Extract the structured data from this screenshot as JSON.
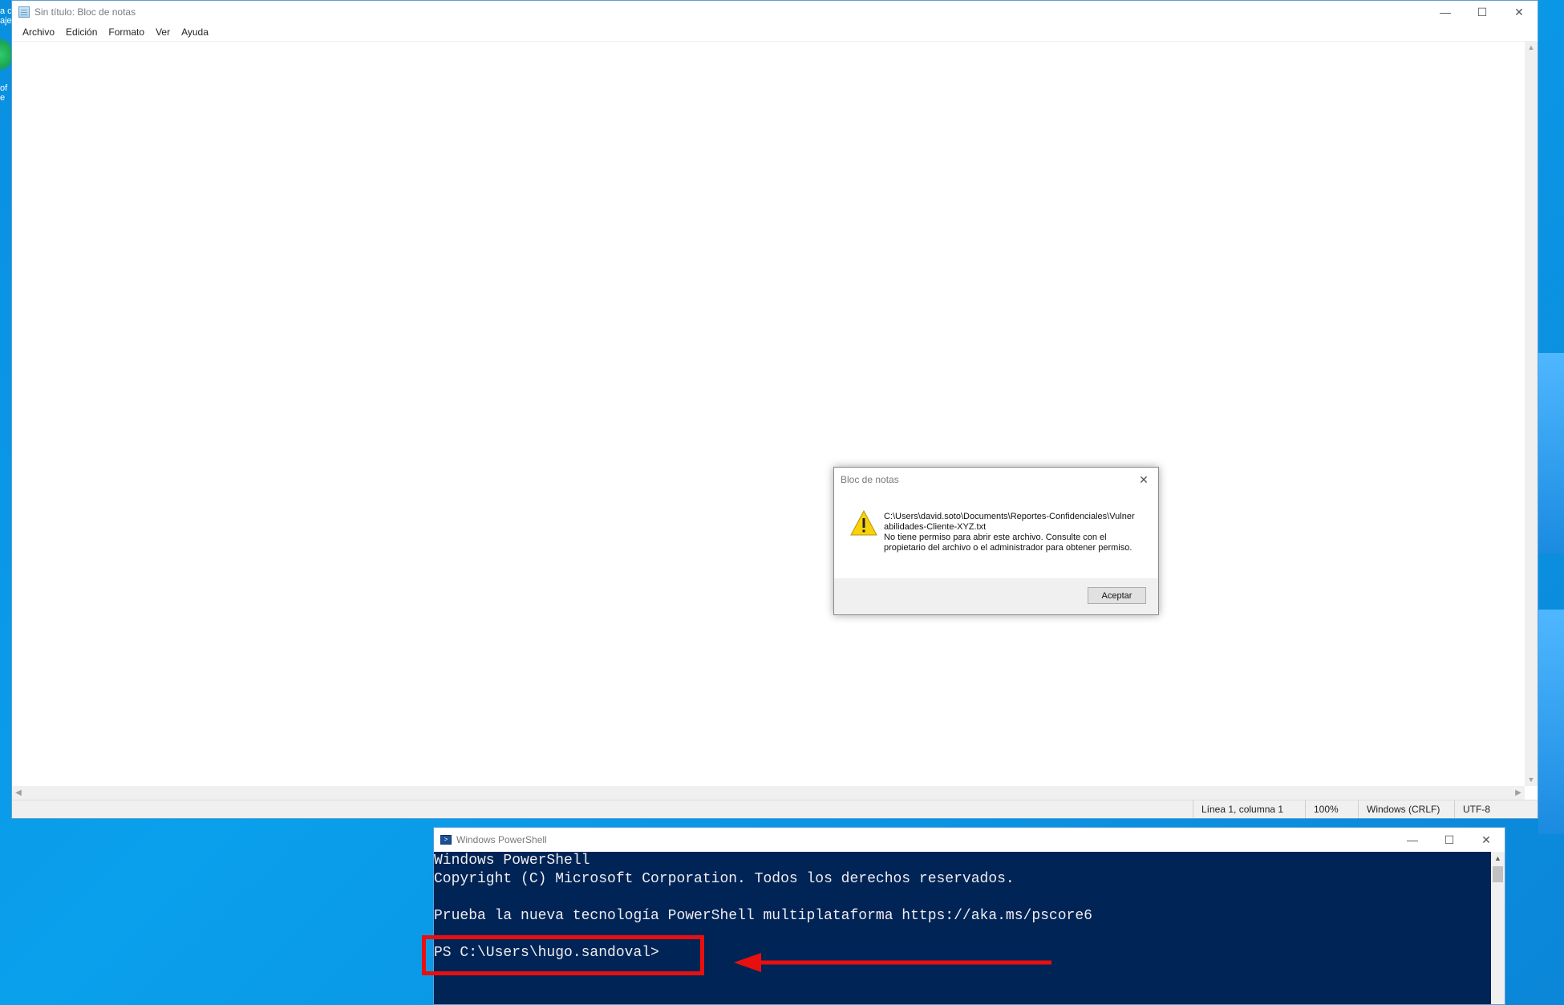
{
  "desktop": {
    "fragments": [
      "a c",
      "aje",
      "of",
      "e"
    ]
  },
  "notepad": {
    "title": "Sin título: Bloc de notas",
    "window_buttons": {
      "minimize": "—",
      "maximize": "☐",
      "close": "✕"
    },
    "menu": [
      "Archivo",
      "Edición",
      "Formato",
      "Ver",
      "Ayuda"
    ],
    "status": {
      "position": "Línea 1, columna 1",
      "zoom": "100%",
      "line_ending": "Windows (CRLF)",
      "encoding": "UTF-8"
    }
  },
  "dialog": {
    "title": "Bloc de notas",
    "close": "✕",
    "path": "C:\\Users\\david.soto\\Documents\\Reportes-Confidenciales\\Vulnerabilidades-Cliente-XYZ.txt",
    "message": "No tiene permiso para abrir este archivo. Consulte con el propietario del archivo o el administrador para obtener permiso.",
    "ok_label": "Aceptar"
  },
  "powershell": {
    "title": "Windows PowerShell",
    "window_buttons": {
      "minimize": "—",
      "maximize": "☐",
      "close": "✕"
    },
    "lines": [
      "Windows PowerShell",
      "Copyright (C) Microsoft Corporation. Todos los derechos reservados.",
      "",
      "Prueba la nueva tecnología PowerShell multiplataforma https://aka.ms/pscore6",
      "",
      "PS C:\\Users\\hugo.sandoval>"
    ]
  },
  "colors": {
    "ps_background": "#012456",
    "annotation_red": "#e8100e",
    "desktop_blue": "#0aa0ec"
  }
}
